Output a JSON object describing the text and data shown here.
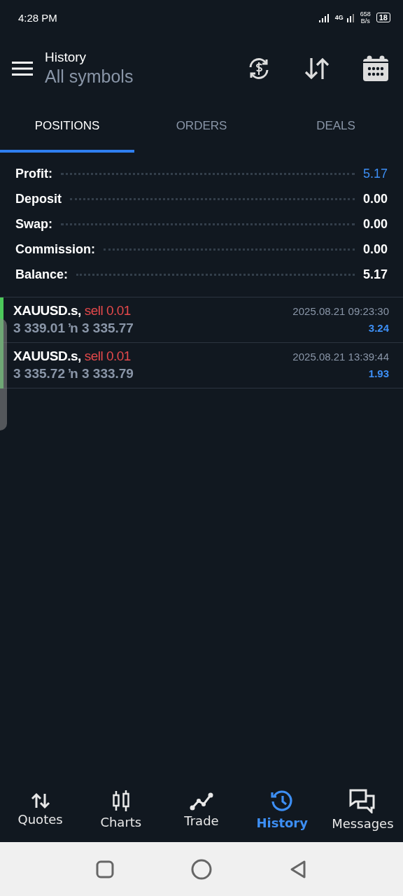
{
  "status_bar": {
    "time": "4:28 PM",
    "network": "4G",
    "speed": "658",
    "speed_unit": "B/s",
    "battery": "18"
  },
  "header": {
    "title": "History",
    "subtitle": "All symbols"
  },
  "tabs": [
    {
      "label": "POSITIONS",
      "selected": true
    },
    {
      "label": "ORDERS",
      "selected": false
    },
    {
      "label": "DEALS",
      "selected": false
    }
  ],
  "summary": [
    {
      "label": "Profit:",
      "value": "5.17",
      "highlight": true
    },
    {
      "label": "Deposit",
      "value": "0.00",
      "highlight": false
    },
    {
      "label": "Swap:",
      "value": "0.00",
      "highlight": false
    },
    {
      "label": "Commission:",
      "value": "0.00",
      "highlight": false
    },
    {
      "label": "Balance:",
      "value": "5.17",
      "highlight": false
    }
  ],
  "positions": [
    {
      "symbol": "XAUUSD.s,",
      "side": "sell 0.01",
      "open_price": "3 339.01",
      "arrow": "ŉ",
      "close_price": "3 335.77",
      "time": "2025.08.21 09:23:30",
      "profit": "3.24"
    },
    {
      "symbol": "XAUUSD.s,",
      "side": "sell 0.01",
      "open_price": "3 335.72",
      "arrow": "ŉ",
      "close_price": "3 333.79",
      "time": "2025.08.21 13:39:44",
      "profit": "1.93"
    }
  ],
  "bottom_nav": [
    {
      "label": "Quotes",
      "kind": "quotes",
      "selected": false
    },
    {
      "label": "Charts",
      "kind": "charts",
      "selected": false
    },
    {
      "label": "Trade",
      "kind": "trade",
      "selected": false
    },
    {
      "label": "History",
      "kind": "history",
      "selected": true
    },
    {
      "label": "Messages",
      "kind": "messages",
      "selected": false
    }
  ]
}
